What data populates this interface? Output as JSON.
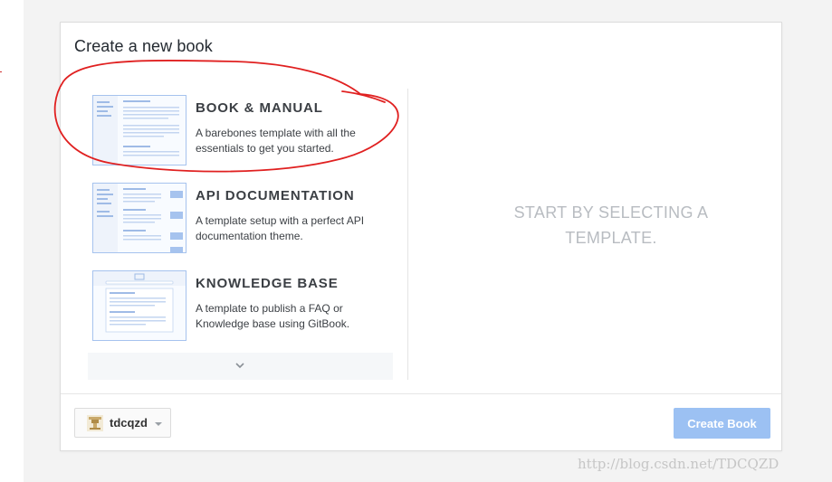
{
  "dialog": {
    "title": "Create a new book"
  },
  "templates": [
    {
      "title": "BOOK & MANUAL",
      "description": "A barebones template with all the essentials to get you started.",
      "thumbnail_icon": "book-layout-thumbnail"
    },
    {
      "title": "API DOCUMENTATION",
      "description": "A template setup with a perfect API documentation theme.",
      "thumbnail_icon": "api-layout-thumbnail"
    },
    {
      "title": "KNOWLEDGE BASE",
      "description": "A template to publish a FAQ or Knowledge base using GitBook.",
      "thumbnail_icon": "knowledge-layout-thumbnail"
    }
  ],
  "more_templates": {
    "icon": "chevron-down-icon"
  },
  "preview": {
    "placeholder": "START BY SELECTING A TEMPLATE."
  },
  "footer": {
    "account_name": "tdcqzd",
    "account_icon": "avatar-icon",
    "create_label": "Create Book"
  },
  "watermark": "http://blog.csdn.net/TDCQZD",
  "colors": {
    "accent_disabled": "#9cc1f3",
    "thumbnail_border": "#a6c3ee",
    "annotation_red": "#e02020",
    "placeholder_text": "#b8bcc1"
  }
}
